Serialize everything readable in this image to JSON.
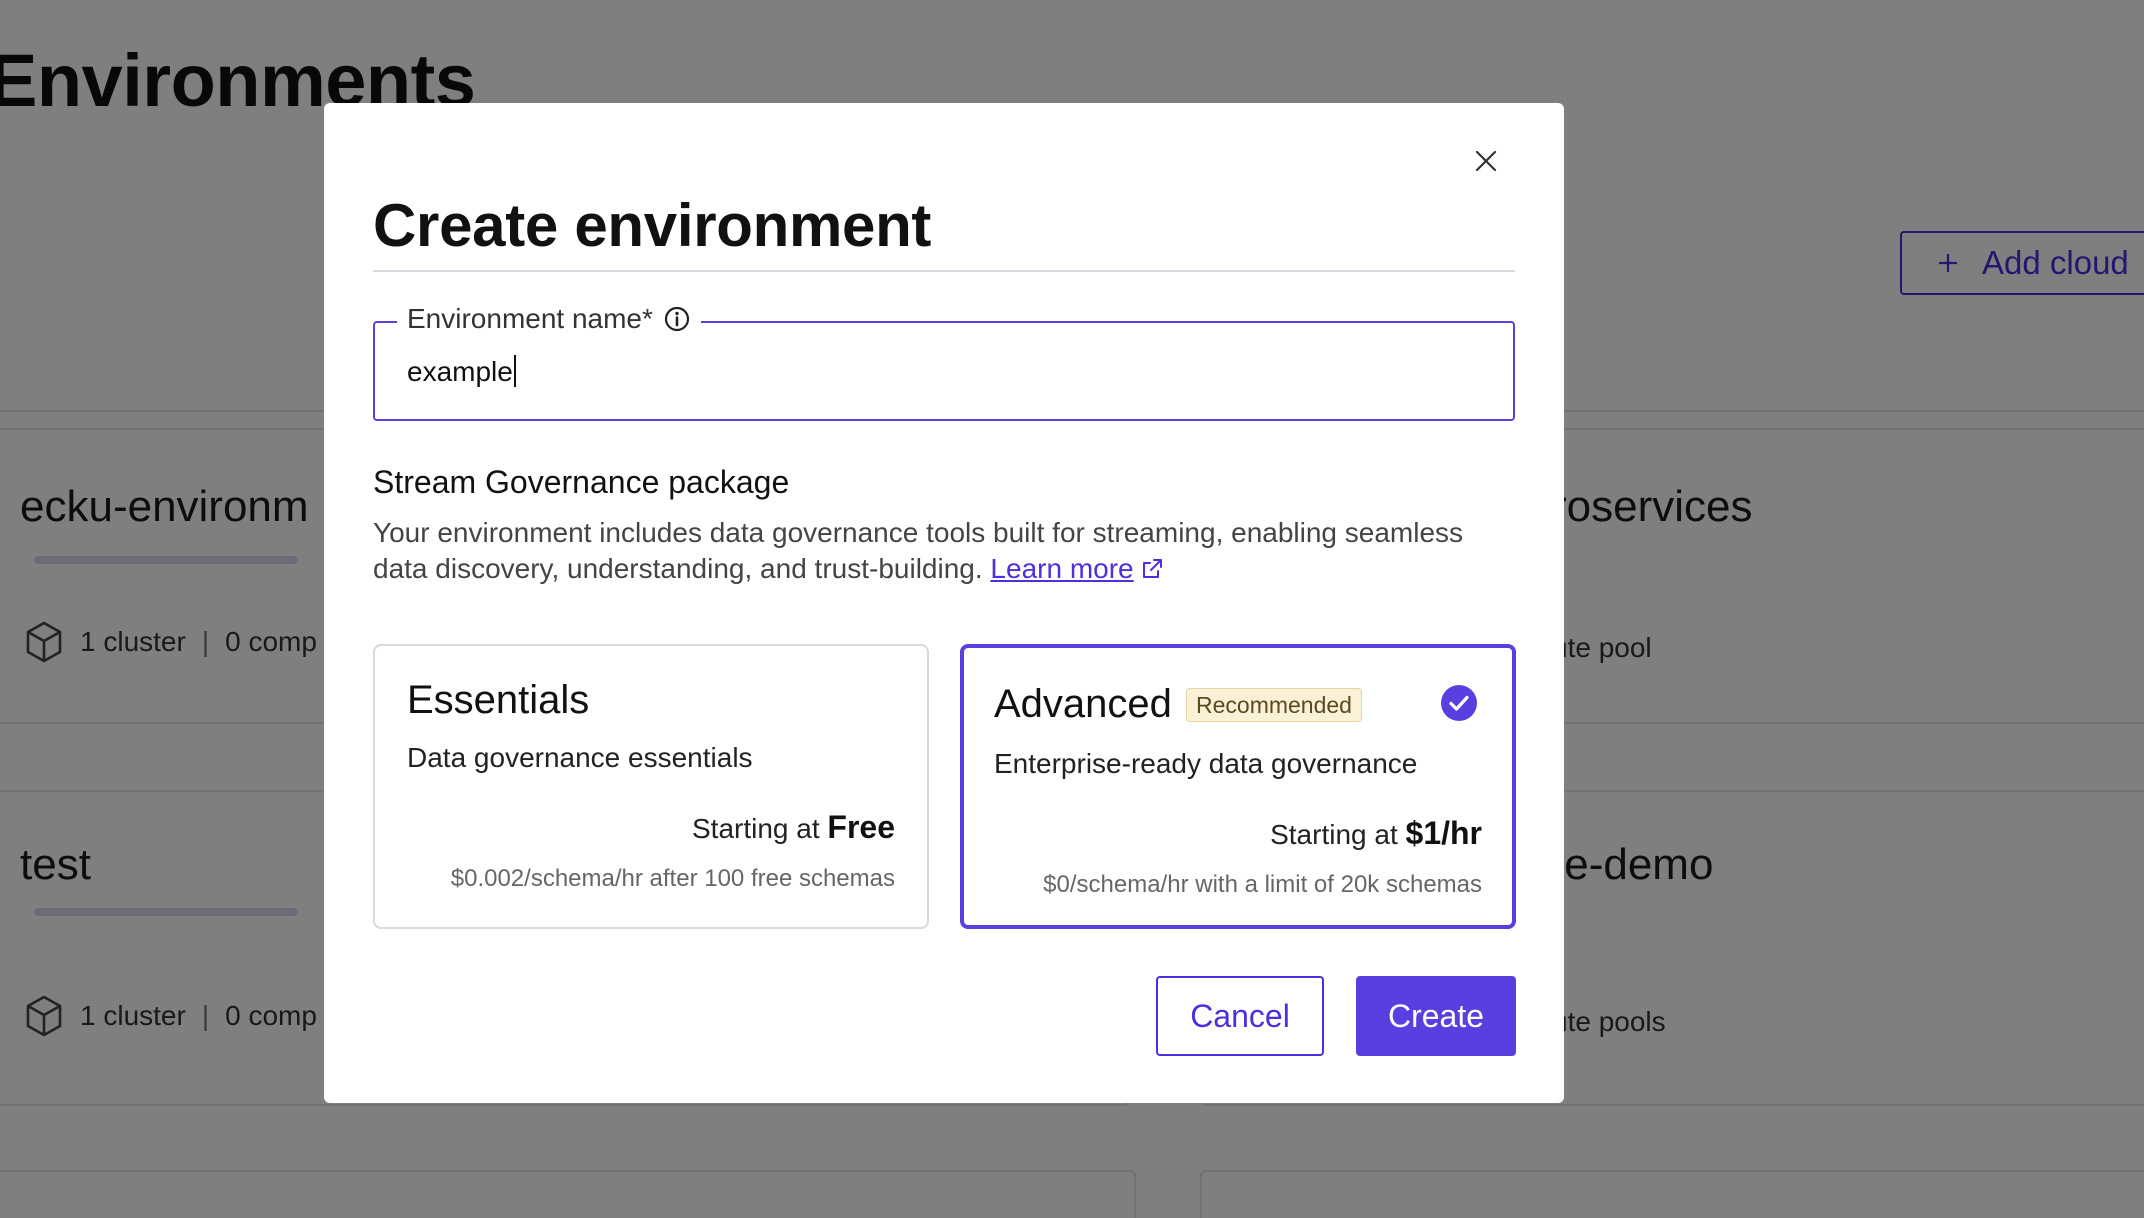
{
  "background": {
    "page_title": "Environments",
    "add_cloud_label": "Add cloud",
    "cards": [
      {
        "name": "ecku-environm",
        "meta_left": "1 cluster",
        "meta_right": "0 comp"
      },
      {
        "name": "roservices",
        "meta_left": "",
        "meta_right": "ute pool"
      },
      {
        "name": "test",
        "meta_left": "1 cluster",
        "meta_right": "0 comp"
      },
      {
        "name": "te-demo",
        "meta_left": "",
        "meta_right": "ute pools"
      }
    ]
  },
  "modal": {
    "title": "Create environment",
    "name_field": {
      "label": "Environment name*",
      "value": "example"
    },
    "section_heading": "Stream Governance package",
    "section_desc": "Your environment includes data governance tools built for streaming, enabling seamless data discovery, understanding, and trust-building.",
    "learn_more": "Learn more",
    "packages": [
      {
        "name": "Essentials",
        "desc": "Data governance essentials",
        "price_prefix": "Starting at",
        "price": "Free",
        "note": "$0.002/schema/hr after 100 free schemas",
        "selected": false
      },
      {
        "name": "Advanced",
        "badge": "Recommended",
        "desc": "Enterprise-ready data governance",
        "price_prefix": "Starting at",
        "price": "$1/hr",
        "note": "$0/schema/hr with a limit of 20k schemas",
        "selected": true
      }
    ],
    "cancel_label": "Cancel",
    "create_label": "Create"
  },
  "colors": {
    "accent": "#5a3fe0",
    "badge_bg": "#fbf1d6"
  },
  "icons": [
    "close-icon",
    "info-icon",
    "external-link-icon",
    "check-circle-icon",
    "plus-icon",
    "cube-icon"
  ]
}
